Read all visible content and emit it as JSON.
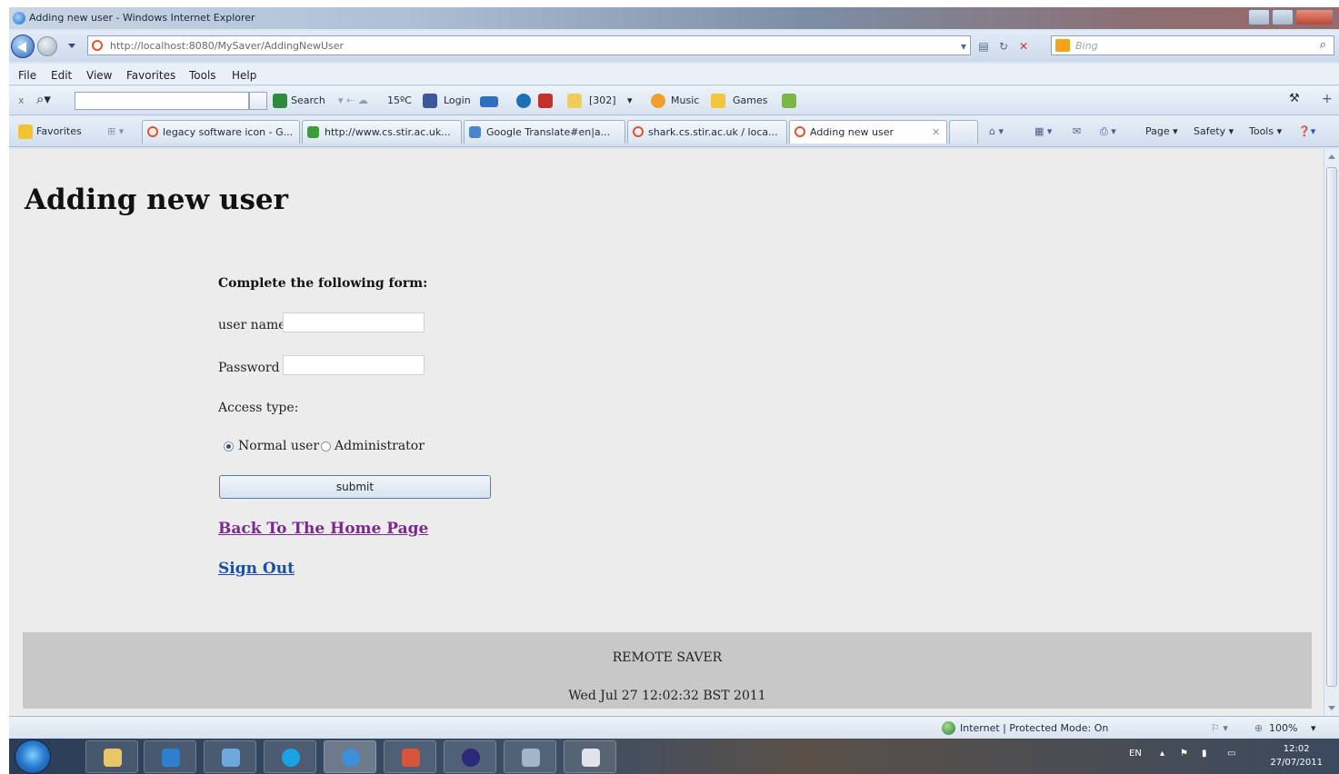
{
  "window": {
    "title": "Adding new user - Windows Internet Explorer"
  },
  "address_bar": {
    "url": "http://localhost:8080/MySaver/AddingNewUser",
    "search_placeholder": "Bing"
  },
  "menu": [
    "File",
    "Edit",
    "View",
    "Favorites",
    "Tools",
    "Help"
  ],
  "toolbar": {
    "search_label": "Search",
    "weather": "15ºC",
    "login_label": "Login",
    "mail_count": "[302]",
    "music_label": "Music",
    "games_label": "Games"
  },
  "favorites_bar": {
    "favorites_label": "Favorites",
    "tabs": [
      "legacy software icon - G...",
      "http://www.cs.stir.ac.uk...",
      "Google Translate#en|a...",
      "shark.cs.stir.ac.uk / loca...",
      "Adding new user"
    ],
    "commands": [
      "Page ▾",
      "Safety ▾",
      "Tools ▾"
    ]
  },
  "page": {
    "heading": "Adding new user",
    "form_title": "Complete the following form:",
    "username_label": "user name",
    "password_label": "Password",
    "access_type_label": "Access type:",
    "radio_normal": "Normal user",
    "radio_admin": "Administrator",
    "submit_label": "submit",
    "back_link": "Back To The Home Page",
    "signout_link": "Sign Out",
    "footer_title": "REMOTE SAVER",
    "footer_date": "Wed Jul 27 12:02:32 BST 2011"
  },
  "status_bar": {
    "zone": "Internet | Protected Mode: On",
    "zoom": "100%"
  },
  "taskbar": {
    "language": "EN",
    "time": "12:02",
    "date": "27/07/2011"
  }
}
